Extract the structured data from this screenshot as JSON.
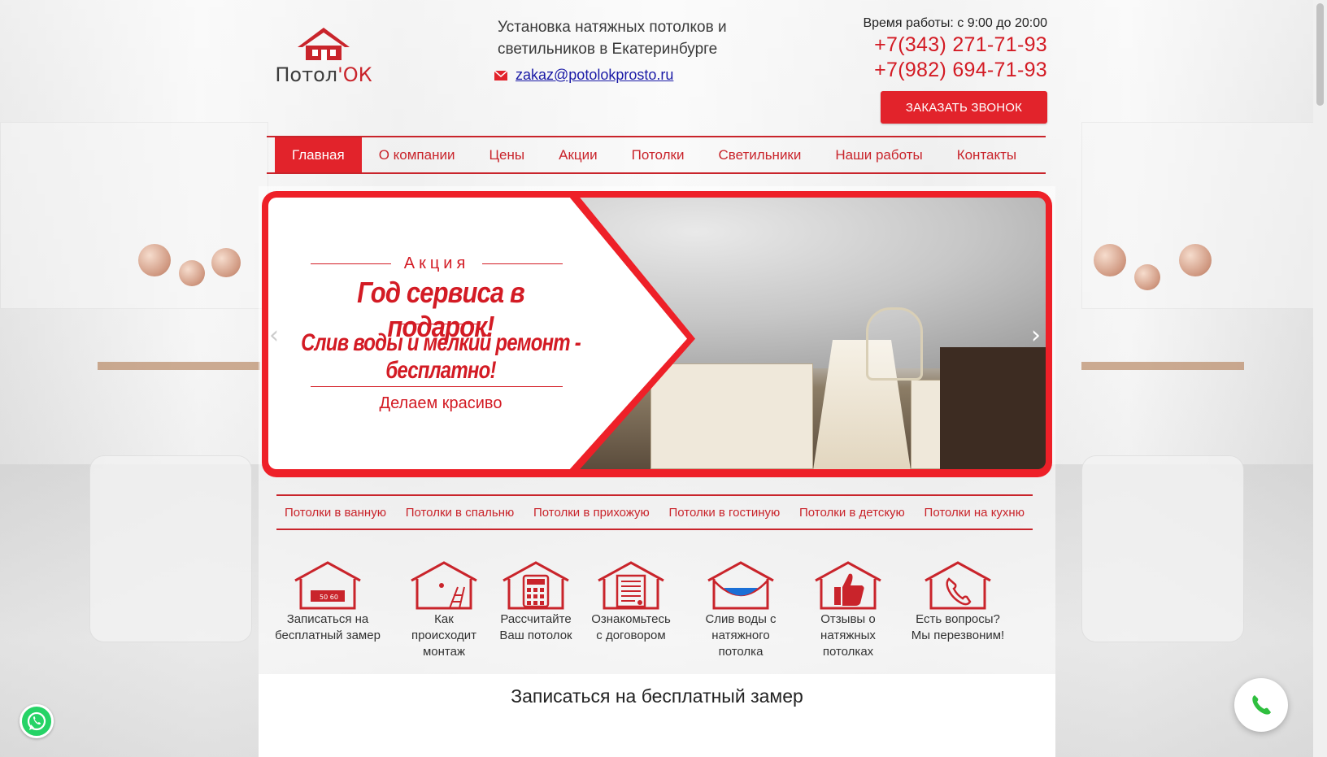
{
  "logo": {
    "text_main": "Потол",
    "text_accent": "'ОК"
  },
  "header": {
    "tagline": "Установка натяжных потолков и светильников в Екатеринбурге",
    "email": "zakaz@potolokprosto.ru",
    "hours": "Время работы: с 9:00 до 20:00",
    "phone1": "+7(343) 271-71-93",
    "phone2": "+7(982) 694-71-93",
    "callback_label": "ЗАКАЗАТЬ ЗВОНОК"
  },
  "nav": {
    "items": [
      {
        "label": "Главная"
      },
      {
        "label": "О компании"
      },
      {
        "label": "Цены"
      },
      {
        "label": "Акции"
      },
      {
        "label": "Потолки"
      },
      {
        "label": "Светильники"
      },
      {
        "label": "Наши работы"
      },
      {
        "label": "Контакты"
      }
    ]
  },
  "slider": {
    "label": "Акция",
    "headline": "Год сервиса в подарок!",
    "subline": "Слив воды и мелкий ремонт - бесплатно!",
    "tagline": "Делаем красиво",
    "prev_icon": "‹",
    "next_icon": "›"
  },
  "categories": [
    {
      "label": "Потолки в ванную"
    },
    {
      "label": "Потолки в спальню"
    },
    {
      "label": "Потолки в прихожую"
    },
    {
      "label": "Потолки в гостиную"
    },
    {
      "label": "Потолки в детскую"
    },
    {
      "label": "Потолки на кухню"
    }
  ],
  "features": [
    {
      "icon": "house-ruler-icon",
      "lines": [
        "Записаться на",
        "бесплатный замер"
      ]
    },
    {
      "icon": "house-ladder-icon",
      "lines": [
        "Как",
        "происходит",
        "монтаж"
      ]
    },
    {
      "icon": "house-calculator-icon",
      "lines": [
        "Рассчитайте",
        "Ваш потолок"
      ]
    },
    {
      "icon": "house-document-icon",
      "lines": [
        "Ознакомьтесь",
        "с договором"
      ]
    },
    {
      "icon": "house-water-icon",
      "lines": [
        "Слив воды с",
        "натяжного",
        "потолка"
      ]
    },
    {
      "icon": "house-thumbs-up-icon",
      "lines": [
        "Отзывы о",
        "натяжных",
        "потолках"
      ]
    },
    {
      "icon": "house-phone-icon",
      "lines": [
        "Есть вопросы?",
        "Мы перезвоним!"
      ]
    }
  ],
  "section_title": "Записаться на бесплатный замер",
  "colors": {
    "accent": "#e2232b",
    "text_red": "#c9242b",
    "whatsapp": "#25d366"
  }
}
